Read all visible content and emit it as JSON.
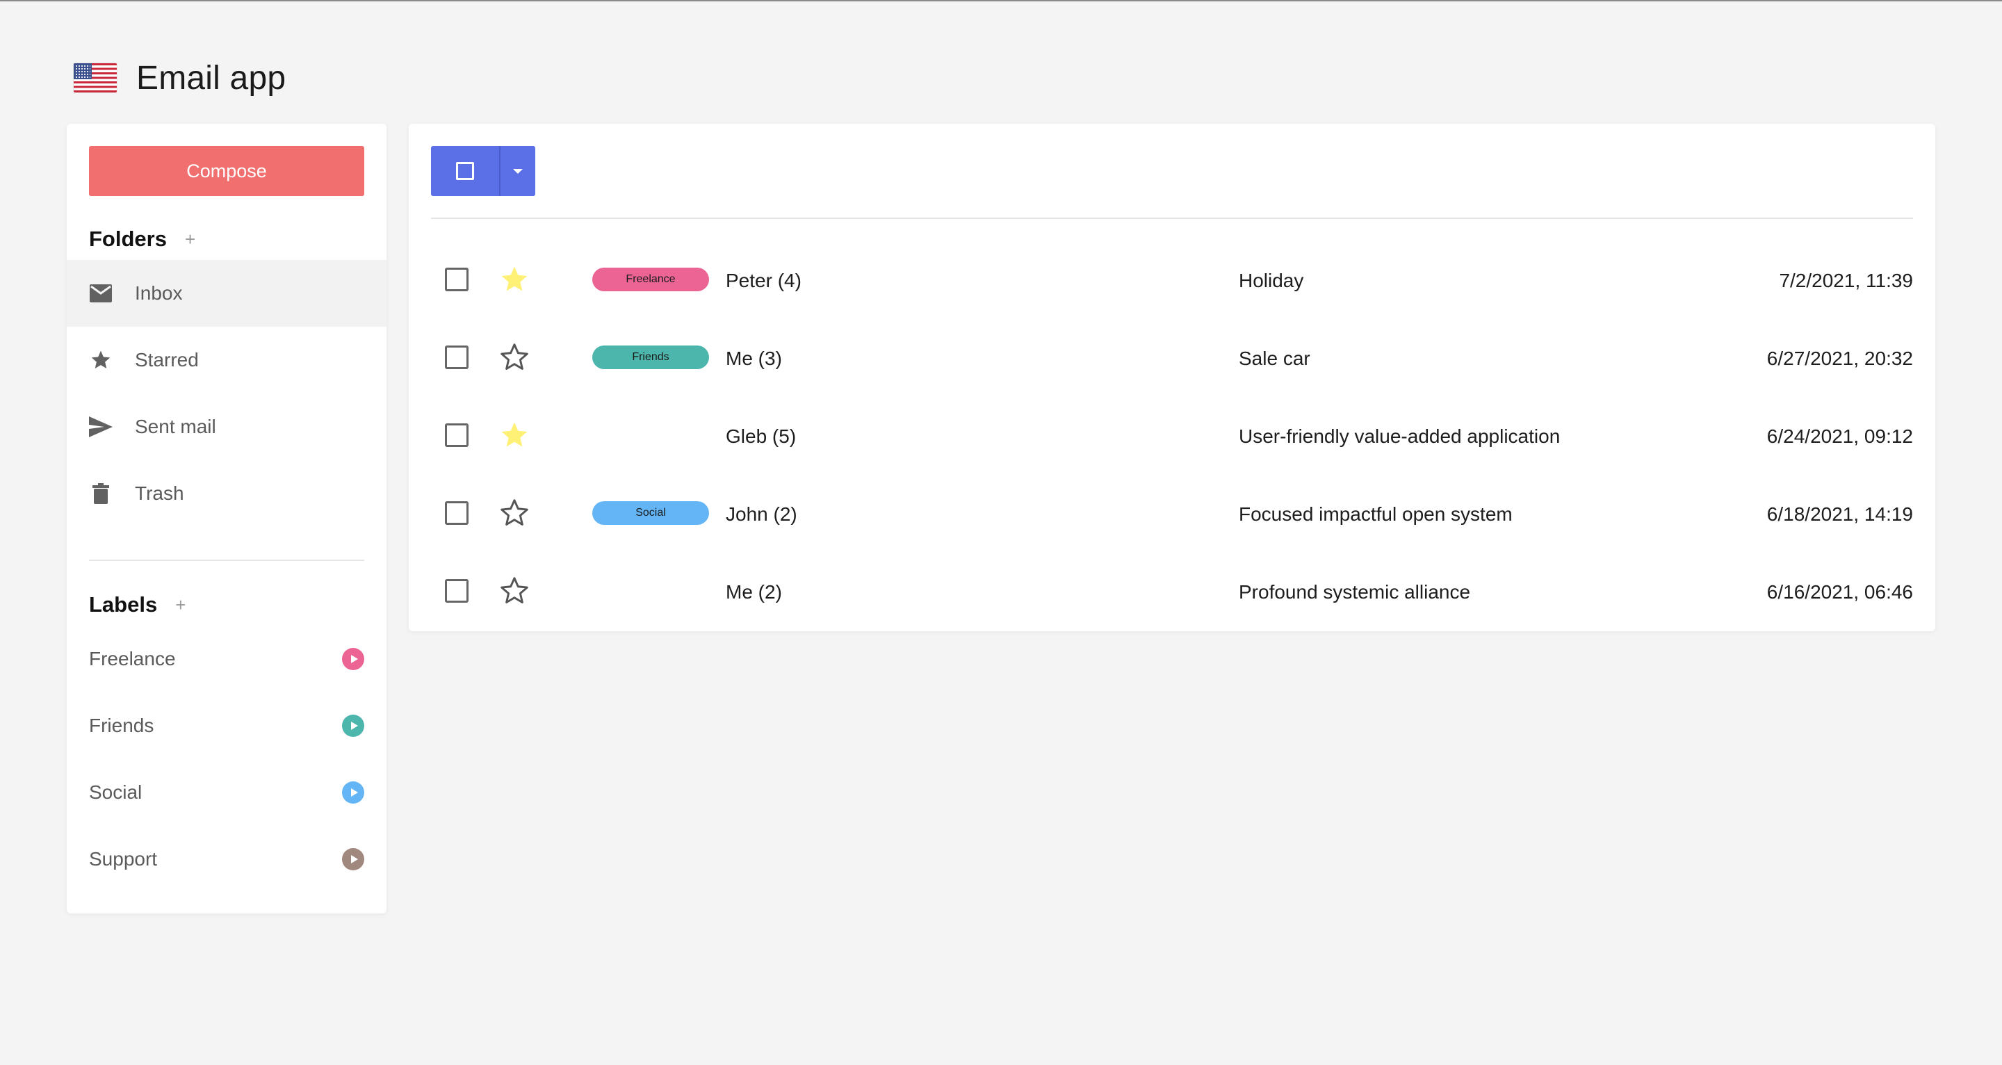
{
  "app": {
    "title": "Email app",
    "flag_icon": "us-flag-icon"
  },
  "sidebar": {
    "compose_label": "Compose",
    "folders_title": "Folders",
    "folders_add": "+",
    "folders": [
      {
        "label": "Inbox",
        "icon": "envelope-icon",
        "active": true
      },
      {
        "label": "Starred",
        "icon": "star-icon",
        "active": false
      },
      {
        "label": "Sent mail",
        "icon": "send-icon",
        "active": false
      },
      {
        "label": "Trash",
        "icon": "trash-icon",
        "active": false
      }
    ],
    "labels_title": "Labels",
    "labels_add": "+",
    "labels": [
      {
        "label": "Freelance",
        "color": "#ec6494"
      },
      {
        "label": "Friends",
        "color": "#4db6ac"
      },
      {
        "label": "Social",
        "color": "#64b5f6"
      },
      {
        "label": "Support",
        "color": "#a1887f"
      }
    ]
  },
  "toolbar": {
    "select_icon": "square-icon",
    "dropdown_icon": "caret-down-icon"
  },
  "emails": [
    {
      "starred": true,
      "label": "Freelance",
      "label_color": "#ec6494",
      "sender": "Peter (4)",
      "subject": "Holiday",
      "date": "7/2/2021, 11:39"
    },
    {
      "starred": false,
      "label": "Friends",
      "label_color": "#4db6ac",
      "sender": "Me (3)",
      "subject": "Sale car",
      "date": "6/27/2021, 20:32"
    },
    {
      "starred": true,
      "label": "",
      "label_color": "",
      "sender": "Gleb (5)",
      "subject": "User-friendly value-added application",
      "date": "6/24/2021, 09:12"
    },
    {
      "starred": false,
      "label": "Social",
      "label_color": "#64b5f6",
      "sender": "John (2)",
      "subject": "Focused impactful open system",
      "date": "6/18/2021, 14:19"
    },
    {
      "starred": false,
      "label": "",
      "label_color": "",
      "sender": "Me (2)",
      "subject": "Profound systemic alliance",
      "date": "6/16/2021, 06:46"
    }
  ],
  "colors": {
    "compose": "#f26f6f",
    "select_button": "#5b6fe6",
    "star_filled": "#fff176",
    "background": "#f4f4f4"
  }
}
